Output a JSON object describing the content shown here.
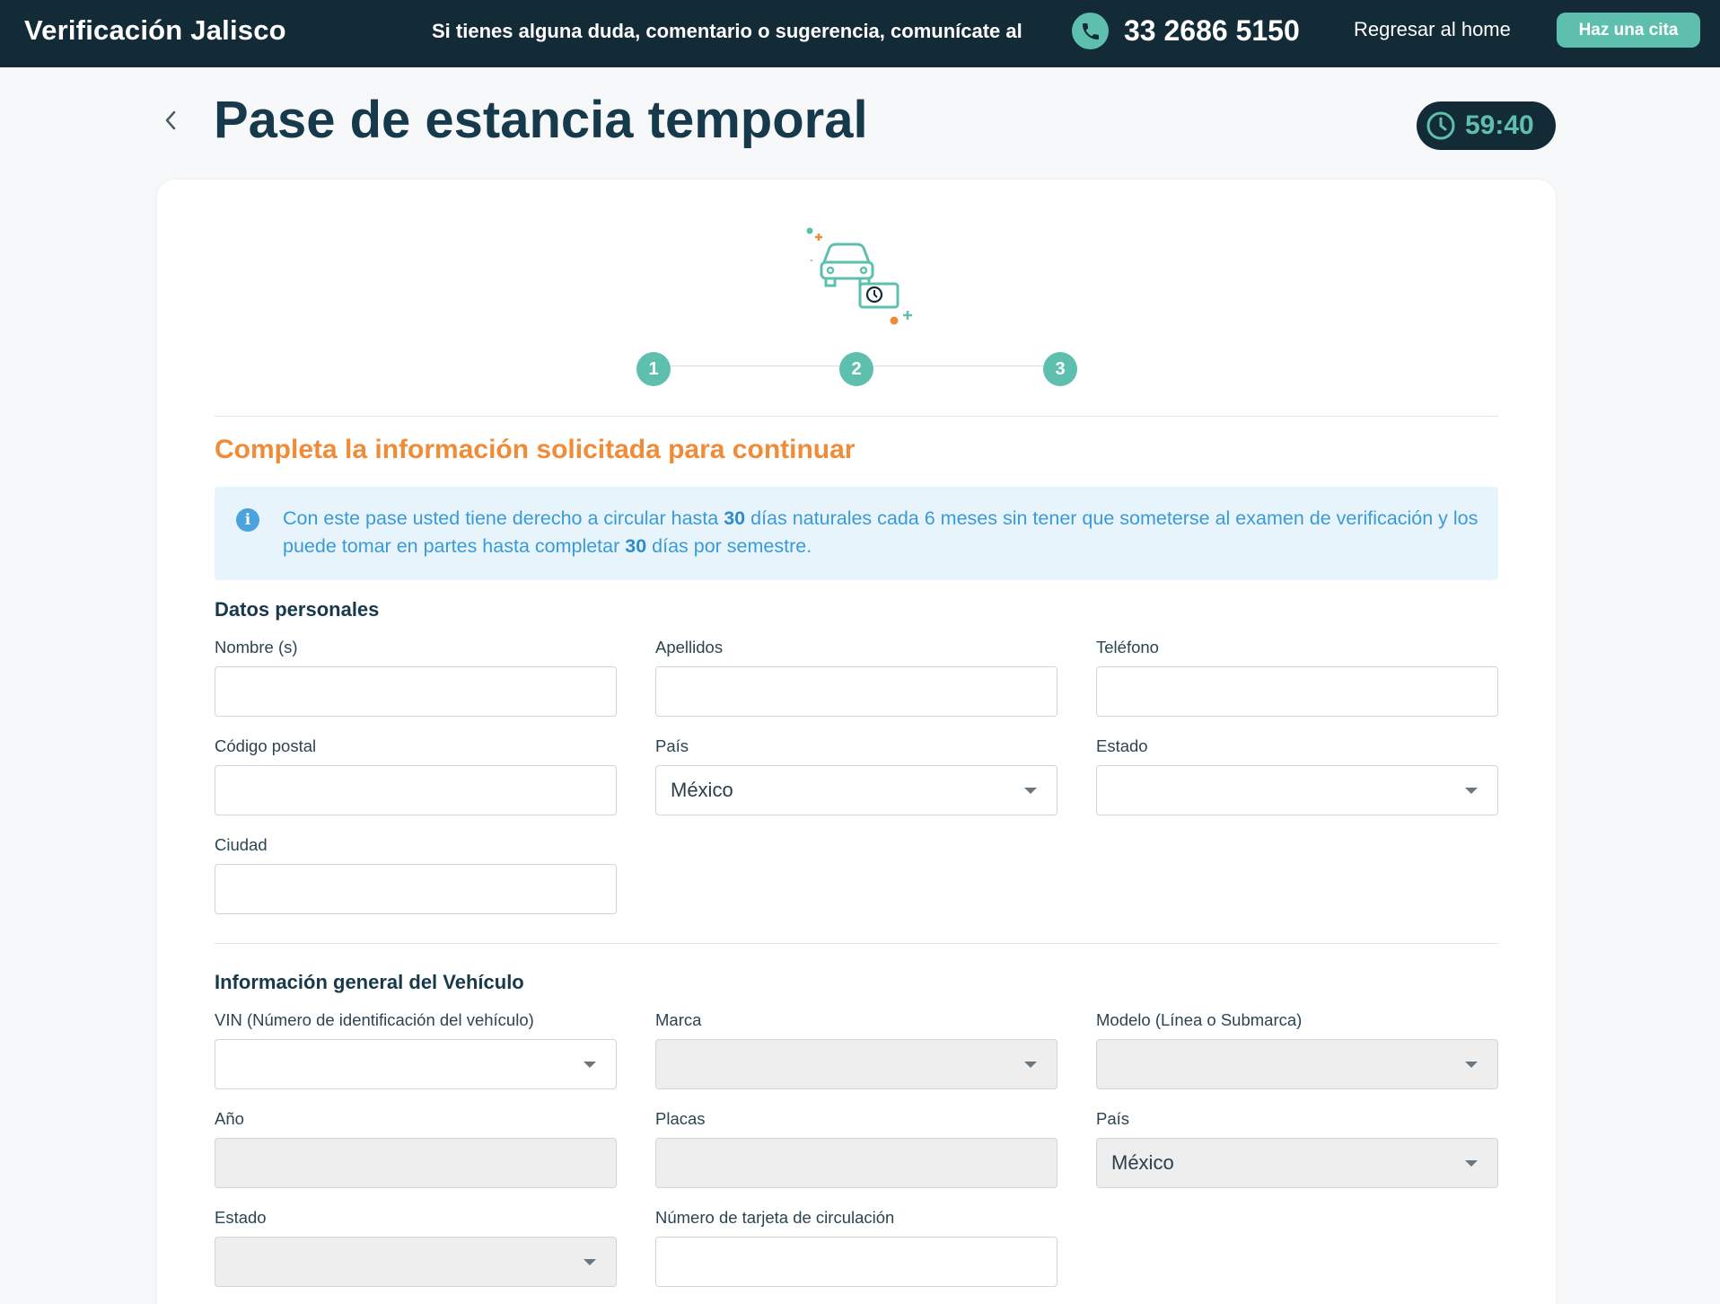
{
  "header": {
    "brand_main": "Verificación",
    "brand_city": "Jalisco",
    "help_text": "Si tienes alguna duda, comentario o sugerencia, comunícate al",
    "phone_icon": "phone-icon",
    "phone": "33 2686 5150",
    "home_link": "Regresar al home",
    "cta_button": "Haz una cita"
  },
  "page": {
    "title": "Pase de estancia temporal",
    "back_icon": "chevron-left-icon",
    "timer_icon": "clock-icon",
    "timer": "59:40"
  },
  "stepper": {
    "steps": [
      "1",
      "2",
      "3"
    ]
  },
  "form": {
    "heading": "Completa la información solicitada para continuar",
    "info": {
      "icon": "info-icon",
      "part1": "Con este pase usted tiene derecho a circular hasta ",
      "bold1": "30",
      "part2": " días naturales cada 6 meses sin tener que someterse al examen de verificación y los puede tomar en partes hasta completar ",
      "bold2": "30",
      "part3": " días por semestre."
    },
    "personal": {
      "title": "Datos personales",
      "nombre": {
        "label": "Nombre (s)",
        "value": ""
      },
      "apellidos": {
        "label": "Apellidos",
        "value": ""
      },
      "telefono": {
        "label": "Teléfono",
        "value": ""
      },
      "codigo_postal": {
        "label": "Código postal",
        "value": ""
      },
      "pais": {
        "label": "País",
        "value": "México"
      },
      "estado": {
        "label": "Estado",
        "value": ""
      },
      "ciudad": {
        "label": "Ciudad",
        "value": ""
      }
    },
    "vehicle": {
      "title": "Información general del Vehículo",
      "vin": {
        "label": "VIN (Número de identificación del vehículo)",
        "value": ""
      },
      "marca": {
        "label": "Marca",
        "value": ""
      },
      "modelo": {
        "label": "Modelo (Línea o Submarca)",
        "value": ""
      },
      "anio": {
        "label": "Año",
        "value": ""
      },
      "placas": {
        "label": "Placas",
        "value": ""
      },
      "pais": {
        "label": "País",
        "value": "México"
      },
      "estado": {
        "label": "Estado",
        "value": ""
      },
      "tarjeta": {
        "label": "Número de tarjeta de circulación",
        "value": ""
      }
    }
  },
  "colors": {
    "navy": "#132a37",
    "teal": "#5fbfae",
    "orange": "#f08c38",
    "info_bg": "#e8f4fb",
    "info_text": "#3a9ad8"
  }
}
